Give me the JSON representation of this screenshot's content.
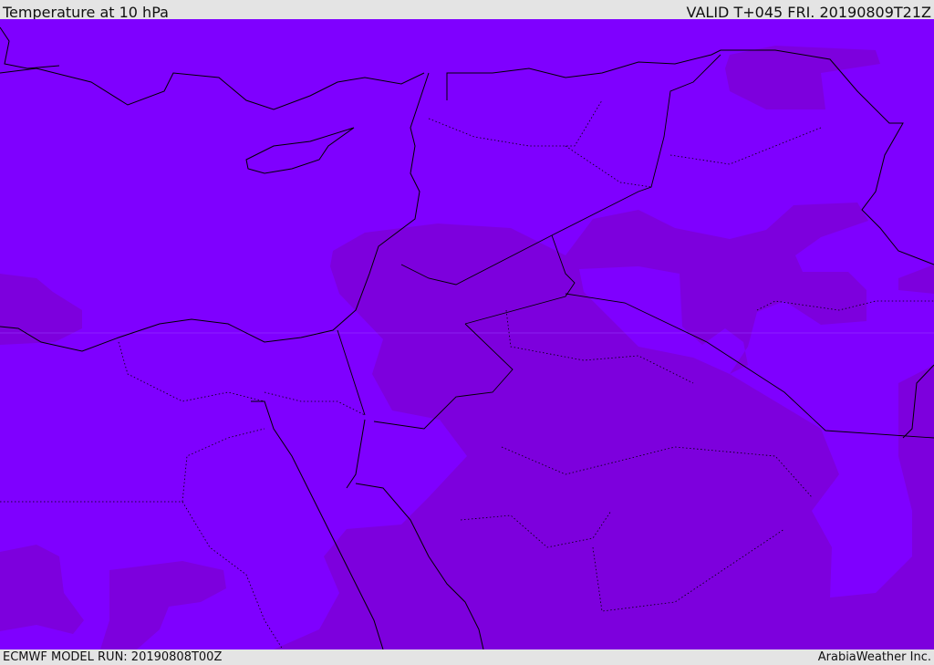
{
  "header": {
    "title": "Temperature at 10 hPa",
    "valid": "VALID T+045 FRI. 20190809T21Z"
  },
  "footer": {
    "model_run": "ECMWF MODEL RUN: 20190808T00Z",
    "credit": "ArabiaWeather Inc."
  },
  "colors": {
    "field_warm": "#7f00ff",
    "field_cool": "#7d00dd",
    "frame": "#e4e4e4"
  }
}
